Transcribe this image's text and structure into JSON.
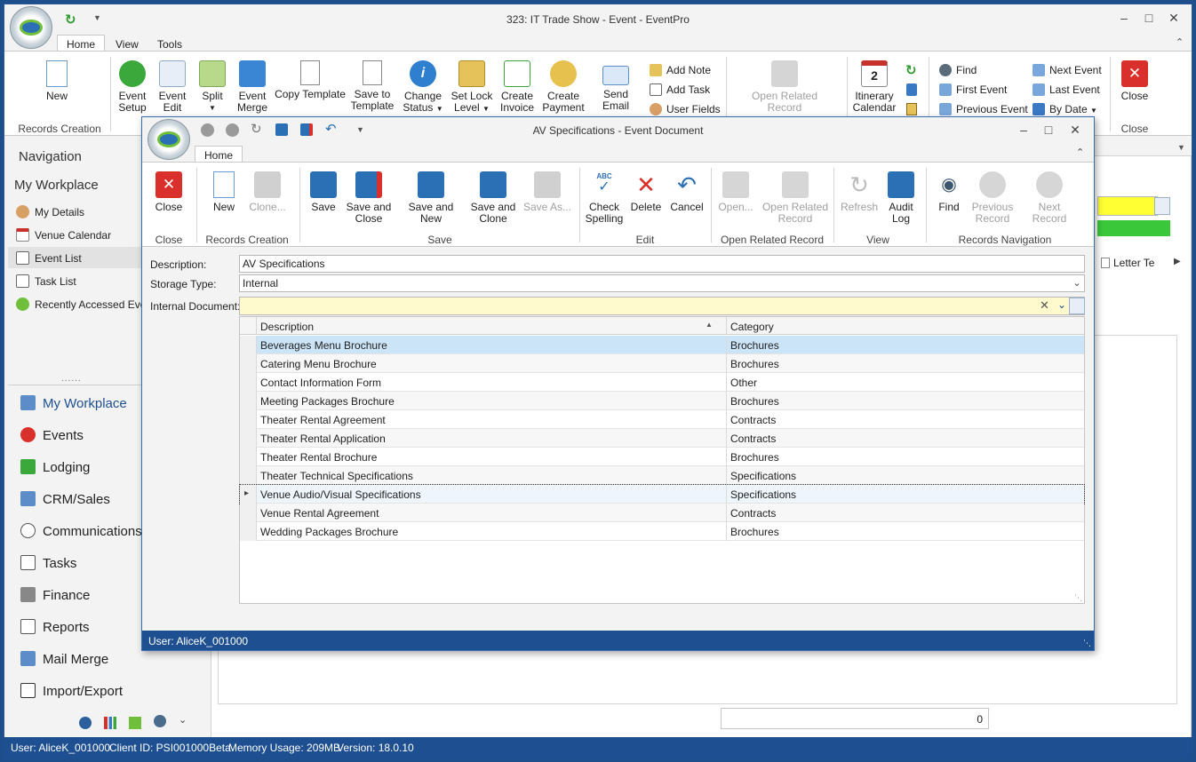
{
  "main": {
    "title": "323: IT Trade Show - Event - EventPro",
    "tabs": [
      "Home",
      "View",
      "Tools"
    ],
    "ribbon": {
      "new": "New",
      "event_setup": [
        "Event",
        "Setup"
      ],
      "event_edit": [
        "Event",
        "Edit"
      ],
      "split": "Split",
      "event_merge": [
        "Event",
        "Merge"
      ],
      "copy_template": "Copy Template",
      "save_to_template": [
        "Save to",
        "Template"
      ],
      "change_status": [
        "Change",
        "Status"
      ],
      "set_lock_level": [
        "Set Lock",
        "Level"
      ],
      "create_invoice": [
        "Create",
        "Invoice"
      ],
      "create_payment": [
        "Create",
        "Payment"
      ],
      "send_email": "Send Email",
      "add_note": "Add Note",
      "add_task": "Add Task",
      "user_fields": "User Fields",
      "open_related_record": [
        "Open Related",
        "Record"
      ],
      "itinerary_calendar": [
        "Itinerary",
        "Calendar"
      ],
      "find": "Find",
      "first_event": "First Event",
      "previous_event": "Previous Event",
      "next_event": "Next Event",
      "last_event": "Last Event",
      "by_date": "By Date",
      "close": "Close",
      "group_records_creation": "Records Creation",
      "group_close": "Close"
    }
  },
  "navigation": {
    "header": "Navigation",
    "section": "My Workplace",
    "items": [
      "My Details",
      "Venue Calendar",
      "Event List",
      "Task List",
      "Recently Accessed Events"
    ],
    "modules": [
      "My Workplace",
      "Events",
      "Lodging",
      "CRM/Sales",
      "Communications",
      "Tasks",
      "Finance",
      "Reports",
      "Mail Merge",
      "Import/Export"
    ]
  },
  "background": {
    "tab_letter": "Letter Te",
    "count": "0"
  },
  "statusbar": {
    "user": "User: AliceK_001000",
    "client_id": "Client ID: PSI001000Beta",
    "memory": "Memory Usage: 209MB",
    "version": "Version: 18.0.10"
  },
  "dialog": {
    "title": "AV Specifications - Event Document",
    "tab": "Home",
    "ribbon": {
      "close": "Close",
      "new": "New",
      "clone": "Clone...",
      "save": "Save",
      "save_and_close": [
        "Save and",
        "Close"
      ],
      "save_and_new": "Save and New",
      "save_and_clone": [
        "Save and",
        "Clone"
      ],
      "save_as": "Save As...",
      "check_spelling": [
        "Check",
        "Spelling"
      ],
      "delete": "Delete",
      "cancel": "Cancel",
      "open": "Open...",
      "open_related_record": [
        "Open Related",
        "Record"
      ],
      "refresh": "Refresh",
      "audit_log": [
        "Audit",
        "Log"
      ],
      "find": "Find",
      "previous_record": [
        "Previous",
        "Record"
      ],
      "next_record": "Next Record",
      "groups": [
        "Close",
        "Records Creation",
        "Save",
        "Edit",
        "Open Related Record",
        "View",
        "Records Navigation"
      ]
    },
    "fields": {
      "description_label": "Description:",
      "description_value": "AV Specifications",
      "storage_type_label": "Storage Type:",
      "storage_type_value": "Internal",
      "internal_document_label": "Internal Document:",
      "internal_document_value": ""
    },
    "grid": {
      "columns": [
        "Description",
        "Category"
      ],
      "rows": [
        [
          "Beverages Menu Brochure",
          "Brochures"
        ],
        [
          "Catering Menu Brochure",
          "Brochures"
        ],
        [
          "Contact Information Form",
          "Other"
        ],
        [
          "Meeting Packages Brochure",
          "Brochures"
        ],
        [
          "Theater Rental Agreement",
          "Contracts"
        ],
        [
          "Theater Rental Application",
          "Contracts"
        ],
        [
          "Theater Rental Brochure",
          "Brochures"
        ],
        [
          "Theater Technical Specifications",
          "Specifications"
        ],
        [
          "Venue Audio/Visual Specifications",
          "Specifications"
        ],
        [
          "Venue Rental Agreement",
          "Contracts"
        ],
        [
          "Wedding Packages Brochure",
          "Brochures"
        ]
      ]
    },
    "status": "User: AliceK_001000"
  },
  "colors": {
    "accent_blue": "#1e4f91",
    "highlight_yellow": "#fffacd",
    "selected_row": "#cce4f7"
  }
}
